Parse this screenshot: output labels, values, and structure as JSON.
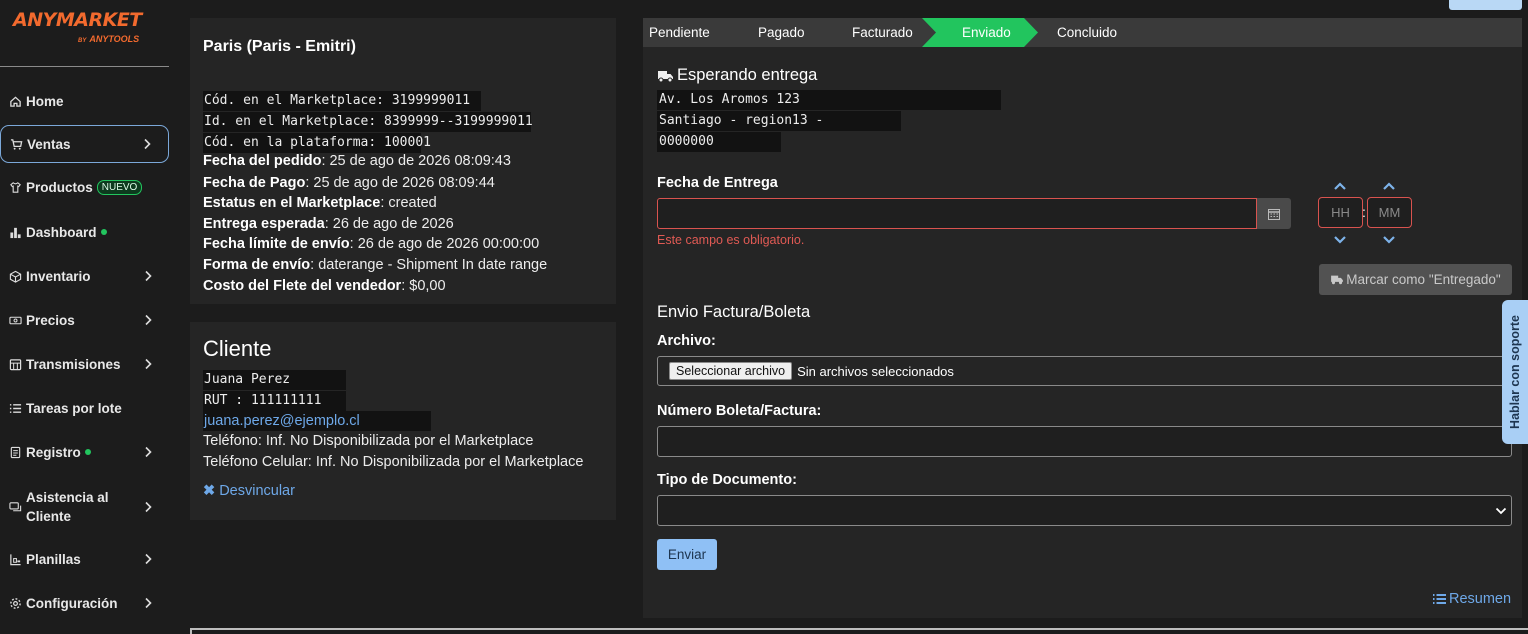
{
  "brand": {
    "name": "ANYMARKET",
    "by_prefix": "BY",
    "by_name": "ANYTOOLS",
    "color": "#f26a2e"
  },
  "sidebar": {
    "items": [
      {
        "label": "Home",
        "icon": "home-icon"
      },
      {
        "label": "Ventas",
        "icon": "cart-icon",
        "active": true
      },
      {
        "label": "Productos",
        "icon": "shirt-icon",
        "badge": "NUEVO"
      },
      {
        "label": "Dashboard",
        "icon": "bar-chart-icon",
        "dot": true
      },
      {
        "label": "Inventario",
        "icon": "box-icon"
      },
      {
        "label": "Precios",
        "icon": "money-icon"
      },
      {
        "label": "Transmisiones",
        "icon": "calendar-grid-icon"
      },
      {
        "label": "Tareas por lote",
        "icon": "list-icon"
      },
      {
        "label": "Registro",
        "icon": "document-icon",
        "dot": true
      },
      {
        "label": "Asistencia al Cliente",
        "icon": "chat-icon"
      },
      {
        "label": "Planillas",
        "icon": "spreadsheet-icon"
      },
      {
        "label": "Configuración",
        "icon": "gear-icon"
      }
    ]
  },
  "order": {
    "title": "Paris (Paris - Emitri)",
    "mono_lines": [
      "Cód. en el Marketplace: 3199999011",
      "Id. en el Marketplace: 8399999--3199999011",
      "Cód. en la plataforma: 100001"
    ],
    "fields": [
      {
        "key": "Fecha del pedido",
        "value": ": 25 de ago de 2026 08:09:43"
      },
      {
        "key": "Fecha de Pago",
        "value": ": 25 de ago de 2026 08:09:44"
      },
      {
        "key": "Estatus en el Marketplace",
        "value": ": created"
      },
      {
        "key": "Entrega esperada",
        "value": ": 26 de ago de 2026"
      },
      {
        "key": "Fecha límite de envío",
        "value": ": 26 de ago de 2026 00:00:00"
      },
      {
        "key": "Forma de envío",
        "value": ": daterange - Shipment In date range"
      },
      {
        "key": "Costo del Flete del vendedor",
        "value": ": $0,00"
      }
    ]
  },
  "client": {
    "title": "Cliente",
    "name": "Juana Perez",
    "rut": "RUT : 111111111",
    "email": "juana.perez@ejemplo.cl",
    "phone": "Teléfono: Inf. No Disponibilizada por el Marketplace",
    "mobile": "Teléfono Celular: Inf. No Disponibilizada por el Marketplace",
    "unlink_label": "Desvincular"
  },
  "steps": [
    {
      "label": "Pendiente"
    },
    {
      "label": "Pagado"
    },
    {
      "label": "Facturado"
    },
    {
      "label": "Enviado",
      "active": true
    },
    {
      "label": "Concluido"
    }
  ],
  "shipping": {
    "title": "Esperando entrega",
    "address": [
      "Av. Los Aromos 123",
      "Santiago - region13 -",
      "0000000"
    ],
    "delivery_date_label": "Fecha de Entrega",
    "delivery_date_value": "",
    "required_error": "Este campo es obligatorio.",
    "hour_placeholder": "HH",
    "minute_placeholder": "MM",
    "time_separator": ":",
    "mark_delivered_label": "Marcar como \"Entregado\""
  },
  "invoice": {
    "title": "Envio Factura/Boleta",
    "file_label": "Archivo:",
    "file_button": "Seleccionar archivo",
    "file_status": "Sin archivos seleccionados",
    "number_label": "Número Boleta/Factura:",
    "number_value": "",
    "doc_type_label": "Tipo de Documento:",
    "doc_type_value": "",
    "send_label": "Enviar"
  },
  "summary_link": "Resumen",
  "support_label": "Hablar con soporte",
  "colors": {
    "accent": "#22c55e",
    "link": "#6ea8e8",
    "error": "#e05a54",
    "primary_button": "#8fc0f5"
  }
}
